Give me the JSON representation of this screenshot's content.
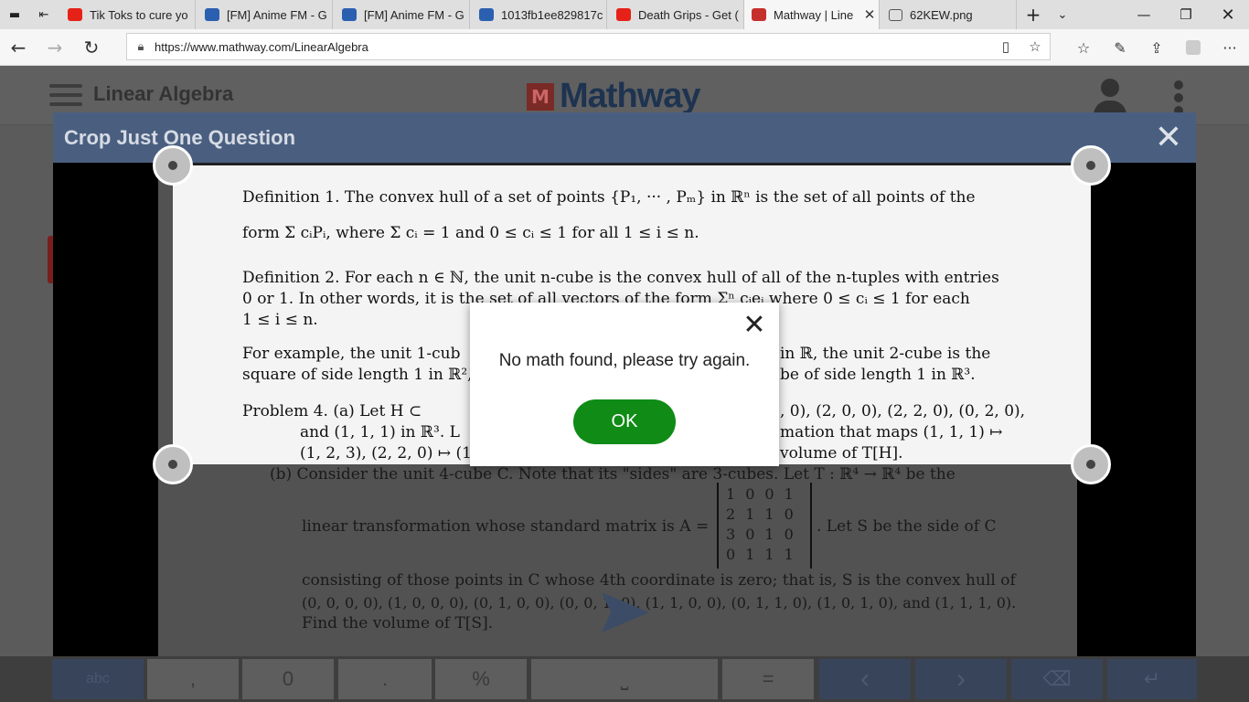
{
  "browser": {
    "tabs": [
      {
        "title": "Tik Toks to cure yo",
        "favicon": "youtube-icon"
      },
      {
        "title": "[FM] Anime FM - G",
        "favicon": "radio-icon"
      },
      {
        "title": "[FM] Anime FM - G",
        "favicon": "radio-icon"
      },
      {
        "title": "1013fb1ee829817c",
        "favicon": "radio-icon"
      },
      {
        "title": "Death Grips - Get (",
        "favicon": "youtube-icon"
      },
      {
        "title": "Mathway | Line",
        "favicon": "mathway-icon",
        "active": true
      },
      {
        "title": "62KEW.png",
        "favicon": "image-icon"
      }
    ],
    "url": "https://www.mathway.com/LinearAlgebra"
  },
  "page": {
    "title": "Linear Algebra",
    "logo_text": "Mathway",
    "logo_mark": "M"
  },
  "crop_modal": {
    "title": "Crop Just One Question"
  },
  "document": {
    "lines": [
      "Definition 1. The convex hull of a set of points {P₁, ··· , Pₘ} in ℝⁿ is the set of all points of the",
      "form  Σ cᵢPᵢ, where  Σ cᵢ = 1 and 0 ≤ cᵢ ≤ 1 for all 1 ≤ i ≤ n.",
      "Definition 2. For each n ∈ ℕ, the unit n-cube is the convex hull of all of the n-tuples with entries",
      "0 or 1. In other words, it is the set of all vectors of the form Σⁿ cᵢeᵢ where 0 ≤ cᵢ ≤ 1 for each",
      "1 ≤ i ≤ n.",
      "For example, the unit 1-cub",
      "in ℝ, the unit 2-cube is the",
      "square of side length 1 in ℝ²,",
      "be of side length 1 in ℝ³.",
      "Problem 4.      (a) Let H ⊂",
      ", 0), (2, 0, 0), (2, 2, 0), (0, 2, 0),",
      "and (1, 1, 1) in ℝ³. L",
      "mation that maps (1, 1, 1) ↦",
      "(1, 2, 3), (2, 2, 0) ↦ (1",
      "volume of T[H]."
    ],
    "dimmed_lines": [
      "(b) Consider the unit 4-cube C. Note that its \"sides\" are 3-cubes. Let T : ℝ⁴ → ℝ⁴ be the",
      "linear transformation whose standard matrix is A =",
      ". Let S be the side of C",
      "consisting of those points in C whose 4th coordinate is zero; that is, S is the convex hull of",
      "(0, 0, 0, 0), (1, 0, 0, 0), (0, 1, 0, 0), (0, 0, 1, 0), (1, 1, 0, 0), (0, 1, 1, 0), (1, 0, 1, 0), and (1, 1, 1, 0).",
      "Find the volume of T[S]."
    ],
    "matrix": [
      [
        "1",
        "0",
        "0",
        "1"
      ],
      [
        "2",
        "1",
        "1",
        "0"
      ],
      [
        "3",
        "0",
        "1",
        "0"
      ],
      [
        "0",
        "1",
        "1",
        "1"
      ]
    ]
  },
  "dialog": {
    "message": "No math found, please try again.",
    "ok_label": "OK"
  },
  "keyboard": {
    "keys": [
      "abc",
      ",",
      "0",
      ".",
      "%",
      "⎵",
      "=",
      "‹",
      "›",
      "⌫",
      "↵"
    ]
  }
}
